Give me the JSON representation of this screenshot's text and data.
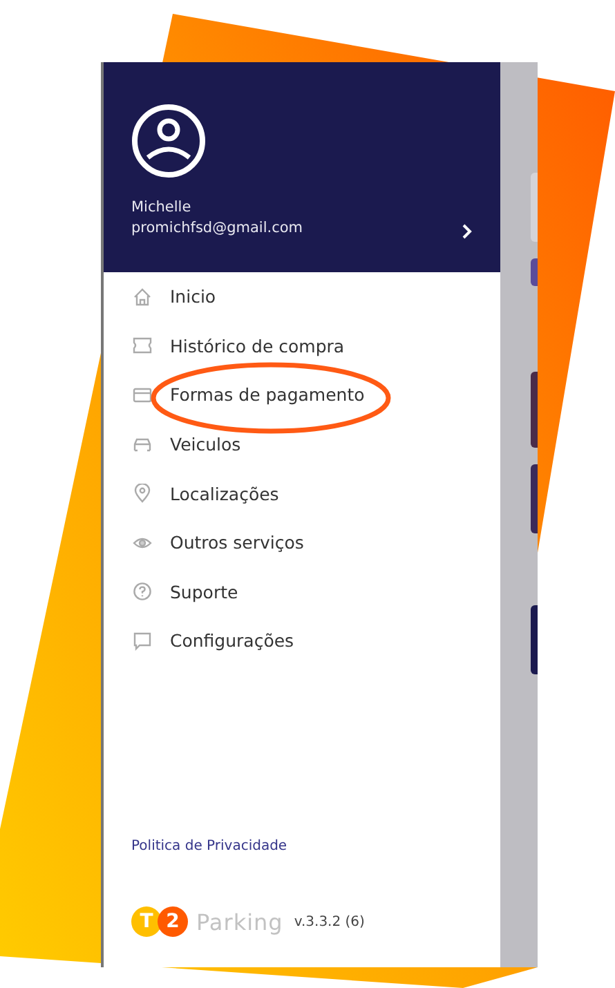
{
  "drawer": {
    "user": {
      "name": "Michelle",
      "email": "promichfsd@gmail.com"
    },
    "menu": [
      {
        "label": "Inicio"
      },
      {
        "label": "Histórico de compra"
      },
      {
        "label": "Formas de pagamento"
      },
      {
        "label": "Veiculos"
      },
      {
        "label": "Localizações"
      },
      {
        "label": "Outros serviços"
      },
      {
        "label": "Suporte"
      },
      {
        "label": "Configurações"
      }
    ],
    "privacy_link": "Politica de Privacidade",
    "logo": {
      "letter": "T",
      "digit": "2",
      "word": "Parking"
    },
    "version": "v.3.3.2 (6)"
  }
}
